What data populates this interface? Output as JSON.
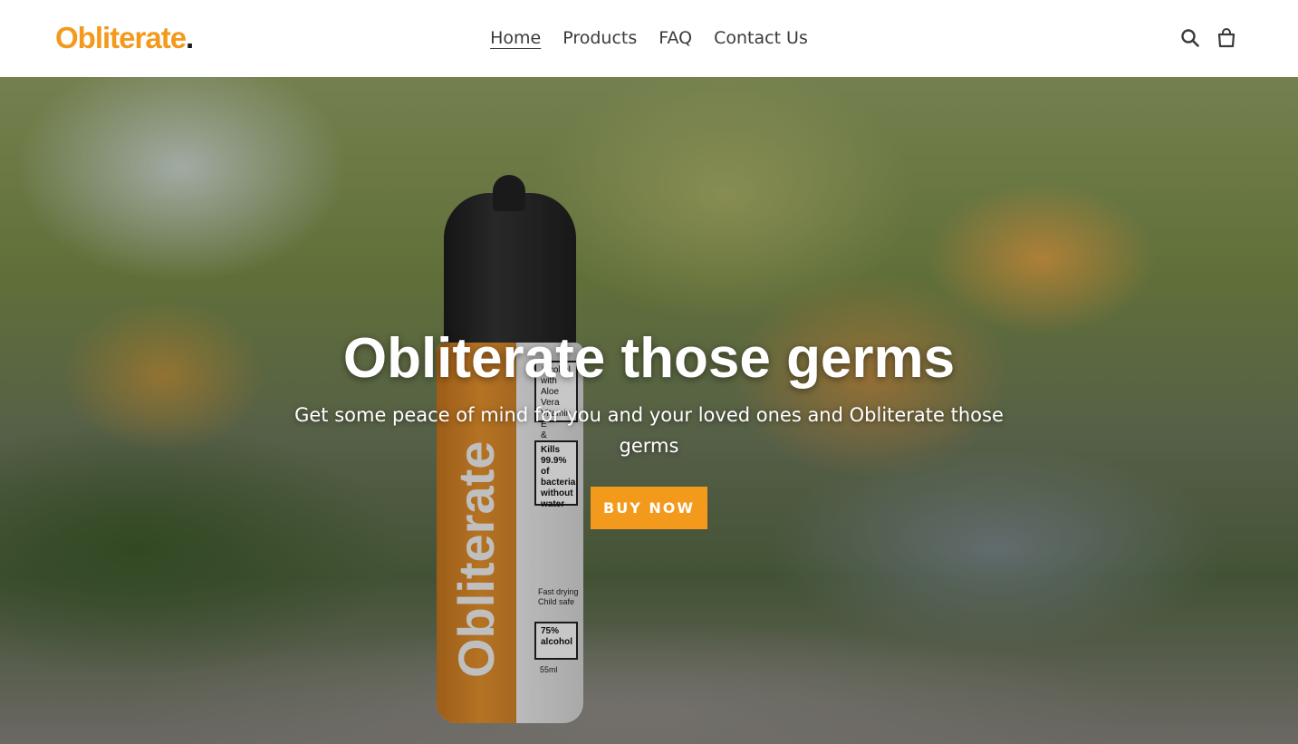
{
  "brand": {
    "logo_text": "Obliterate",
    "logo_dot": ".",
    "accent_color": "#f39a1c"
  },
  "nav": {
    "items": [
      {
        "label": "Home",
        "active": true
      },
      {
        "label": "Products"
      },
      {
        "label": "FAQ"
      },
      {
        "label": "Contact Us"
      }
    ]
  },
  "header_icons": {
    "search": "search-icon",
    "cart": "cart-icon"
  },
  "hero": {
    "title": "Obliterate those germs",
    "subtitle": "Get some peace of mind for you and your loved ones and Obliterate those germs",
    "cta_label": "BUY NOW"
  },
  "product": {
    "brand_text": "Obliterate",
    "label_box_1": "Alcohol\nwith Aloe Vera\nVitamin E\n& Orange Oil",
    "label_box_2": "Kills\n99.9% of\nbacteria\nwithout\nwater",
    "label_small": "Fast drying\nChild safe",
    "label_box_3": "75%\nalcohol",
    "volume": "55ml"
  }
}
